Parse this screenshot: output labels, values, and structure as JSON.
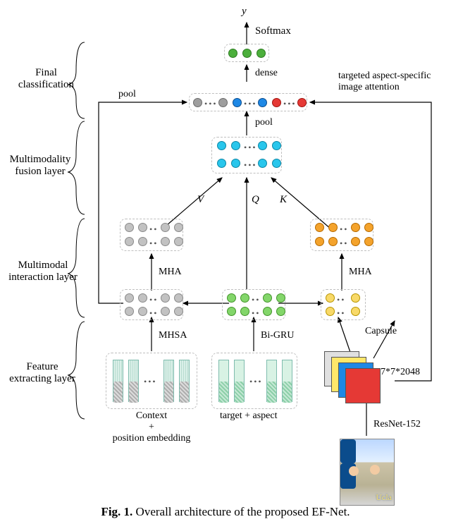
{
  "output_symbol": "y",
  "softmax_label": "Softmax",
  "dense_label": "dense",
  "pool_label_left": "pool",
  "pool_label_mid": "pool",
  "attention_right_line1": "targeted aspect-specific",
  "attention_right_line2": "image attention",
  "vqk": {
    "V": "V",
    "Q": "Q",
    "K": "K"
  },
  "mha_left": "MHA",
  "mha_right": "MHA",
  "mhsa": "MHSA",
  "bigru": "Bi-GRU",
  "capsule": "Capsule",
  "img_dim": "7*7*2048",
  "resnet": "ResNet-152",
  "context_label_line1": "Context",
  "context_label_plus": "+",
  "context_label_line2": "position embedding",
  "target_aspect_label": "target + aspect",
  "layer_labels": {
    "final": "Final\nclassification",
    "fusion": "Multimodality\nfusion layer",
    "interaction": "Multimodal\ninteraction layer",
    "feature": "Feature\nextracting layer"
  },
  "caption_prefix": "Fig. 1.",
  "caption_text": " Overall architecture of the proposed EF-Net.",
  "photo_logo": "Ucla",
  "colors": {
    "green": "#4caf3c",
    "gray": "#9e9e9e",
    "blue": "#1e88e5",
    "red": "#e53935",
    "cyan": "#29c6ec",
    "grayL": "#c2c2c2",
    "orange": "#f4a32c",
    "yellow": "#f8d968",
    "lime": "#83d66a"
  }
}
